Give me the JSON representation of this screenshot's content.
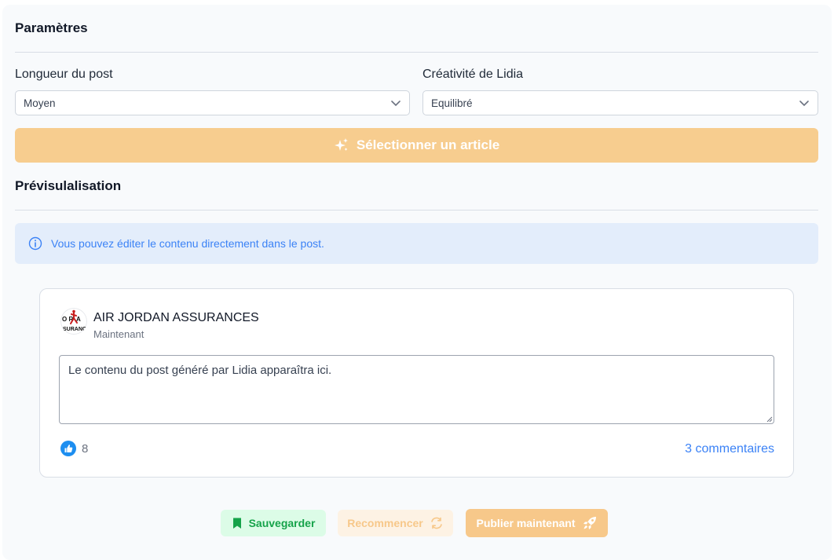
{
  "params": {
    "title": "Paramètres",
    "length_label": "Longueur du post",
    "length_value": "Moyen",
    "creativity_label": "Créativité de Lidia",
    "creativity_value": "Equilibré",
    "select_article_label": "Sélectionner un article"
  },
  "preview": {
    "title": "Prévisulalisation",
    "info_text": "Vous pouvez éditer le contenu directement dans le post.",
    "company_name": "AIR JORDAN ASSURANCES",
    "timestamp": "Maintenant",
    "post_placeholder": "Le contenu du post généré par Lidia apparaîtra ici.",
    "likes_count": "8",
    "comments_label": "3 commentaires"
  },
  "actions": {
    "save_label": "Sauvegarder",
    "restart_label": "Recommencer",
    "publish_label": "Publier maintenant"
  },
  "colors": {
    "accent": "#f7cd8f",
    "save": "#16a34a",
    "info": "#3b82f6",
    "like": "#1d8ef0"
  },
  "icons": [
    "chevron-down-icon",
    "sparkles-icon",
    "info-icon",
    "thumbs-up-icon",
    "bookmark-icon",
    "refresh-icon",
    "rocket-icon"
  ]
}
